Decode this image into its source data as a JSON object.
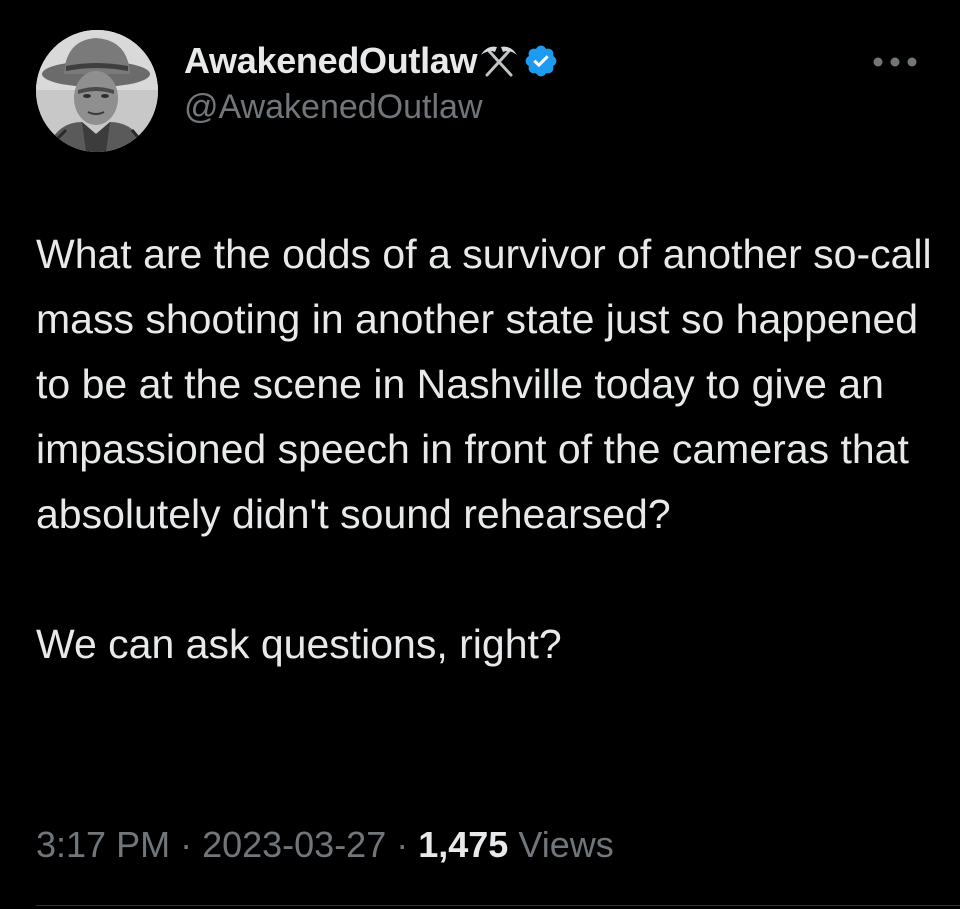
{
  "author": {
    "display_name": "AwakenedOutlaw",
    "handle": "@AwakenedOutlaw",
    "avatar_icon": "cowboy-portrait-avatar",
    "badge_emoji_icon": "hammer-and-pick-icon",
    "verified_icon": "verified-badge-icon"
  },
  "menu": {
    "more_icon": "more-options-icon"
  },
  "tweet": {
    "paragraphs": [
      "What are the odds of a survivor of another so-call mass shooting in another state just so happened to be at the scene in Nashville today to give an impassioned speech in front of the cameras that absolutely didn't sound rehearsed?",
      "We can ask questions, right?"
    ]
  },
  "meta": {
    "time": "3:17 PM",
    "separator": " · ",
    "date": "2023-03-27",
    "views_count": "1,475",
    "views_label": "Views"
  },
  "colors": {
    "background": "#000000",
    "text": "#e7e9ea",
    "secondary_text": "#71767b",
    "verified_blue": "#1d9bf0"
  }
}
